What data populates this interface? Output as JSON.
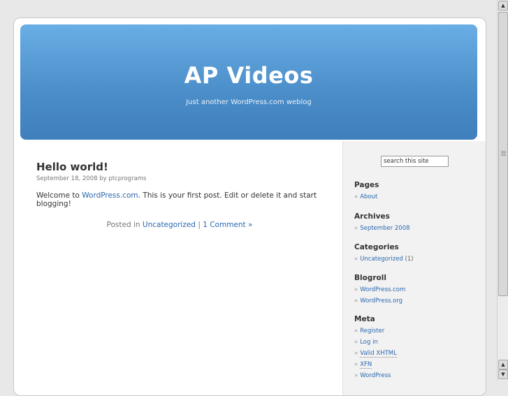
{
  "header": {
    "title": "AP Videos",
    "description": "Just another WordPress.com weblog"
  },
  "post": {
    "title": "Hello world!",
    "meta": "September 18, 2008 by ptcprograms",
    "body_prefix": "Welcome to ",
    "body_link": "WordPress.com",
    "body_suffix": ". This is your first post. Edit or delete it and start blogging!",
    "footer_prefix": "Posted in ",
    "category_link": "Uncategorized",
    "separator": " | ",
    "comments_link": "1 Comment »"
  },
  "sidebar": {
    "search_value": "search this site",
    "pages": {
      "heading": "Pages",
      "items": [
        "About"
      ]
    },
    "archives": {
      "heading": "Archives",
      "items": [
        "September 2008"
      ]
    },
    "categories": {
      "heading": "Categories",
      "items": [
        {
          "label": "Uncategorized",
          "count": "(1)"
        }
      ]
    },
    "blogroll": {
      "heading": "Blogroll",
      "items": [
        "WordPress.com",
        "WordPress.org"
      ]
    },
    "meta": {
      "heading": "Meta",
      "items": [
        "Register",
        "Log in",
        "Valid XHTML",
        "XFN",
        "WordPress"
      ]
    }
  },
  "bullet": "»",
  "colors": {
    "link": "#2a68b0",
    "header_top": "#6aaee6",
    "header_bottom": "#3f7fbc"
  }
}
